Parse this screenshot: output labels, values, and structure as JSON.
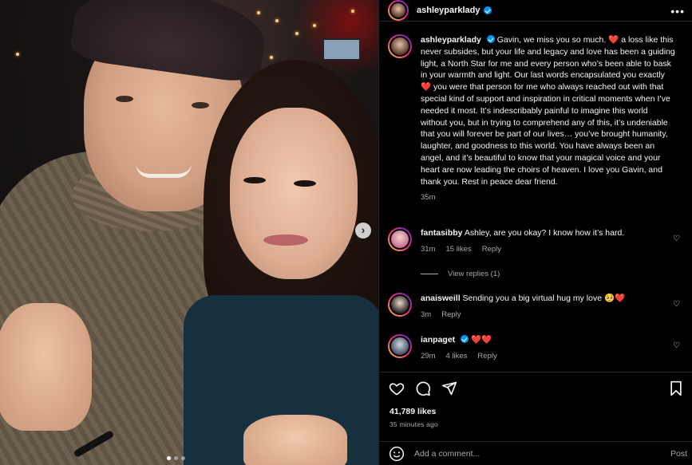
{
  "header": {
    "username": "ashleyparklady",
    "more_icon": "more-icon"
  },
  "caption": {
    "username": "ashleyparklady",
    "text": "Gavin, we miss you so much. ❤️ a loss like this never subsides, but your life and legacy and love has been a guiding light, a North Star for me and every person who’s been able to bask in your warmth and light. Our last words encapsulated you exactly ❤️ you were that person for me who always reached out with that special kind of support and inspiration in critical moments when I’ve needed it most. It’s indescribably painful to imagine this world without you, but in trying to comprehend any of this, it’s undeniable that you will forever be part of our lives… you’ve brought humanity, laughter, and goodness to this world. You have always been an angel, and it’s beautiful to know that your magical voice and your heart are now leading the choirs of heaven. I love you Gavin, and thank you. Rest in peace dear friend.",
    "age": "35m"
  },
  "comments": [
    {
      "username": "fantasibby",
      "text": "Ashley, are you okay? I know how it’s hard.",
      "age": "31m",
      "likes": "15 likes",
      "reply": "Reply"
    },
    {
      "username": "anaisweill",
      "text": "Sending you a big virtual hug my love 🥺❤️",
      "age": "3m",
      "likes": "",
      "reply": "Reply"
    },
    {
      "username": "ianpaget",
      "text": "❤️❤️",
      "age": "29m",
      "likes": "4 likes",
      "reply": "Reply"
    }
  ],
  "view_replies": "View replies (1)",
  "likes_count": "41,789 likes",
  "timestamp": "35 minutes ago",
  "comment_bar": {
    "placeholder": "Add a comment...",
    "post_label": "Post"
  },
  "carousel": {
    "slides": 3,
    "current": 1
  }
}
